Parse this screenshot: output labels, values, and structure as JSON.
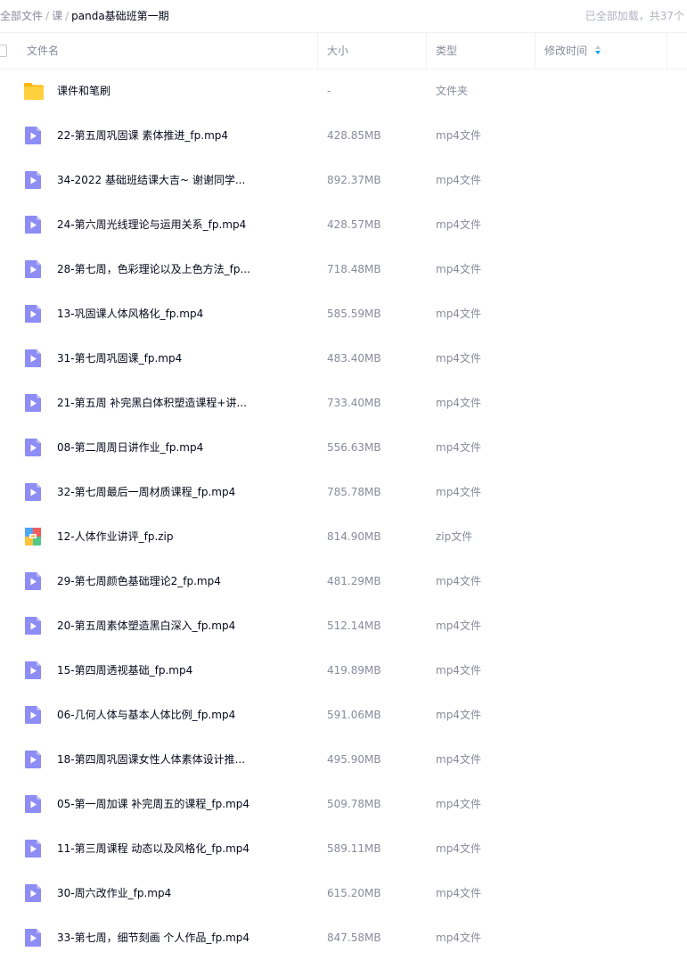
{
  "breadcrumb": {
    "items": [
      "全部文件",
      "课"
    ],
    "separator": "/",
    "current": "panda基础班第一期"
  },
  "load_status": "已全部加载，共37个",
  "columns": {
    "name": "文件名",
    "size": "大小",
    "type": "类型",
    "modified": "修改时间"
  },
  "colors": {
    "accent": "#06a7ff",
    "video_icon": "#8e8cf5",
    "folder_icon": "#ffc52e"
  },
  "files": [
    {
      "icon": "folder-icon",
      "name": "课件和笔刷",
      "size": "-",
      "type": "文件夹"
    },
    {
      "icon": "video-file-icon",
      "name": "22-第五周巩固课 素体推进_fp.mp4",
      "size": "428.85MB",
      "type": "mp4文件"
    },
    {
      "icon": "video-file-icon",
      "name": "34-2022 基础班结课大吉~ 谢谢同学...",
      "size": "892.37MB",
      "type": "mp4文件"
    },
    {
      "icon": "video-file-icon",
      "name": "24-第六周光线理论与运用关系_fp.mp4",
      "size": "428.57MB",
      "type": "mp4文件"
    },
    {
      "icon": "video-file-icon",
      "name": "28-第七周，色彩理论以及上色方法_fp...",
      "size": "718.48MB",
      "type": "mp4文件"
    },
    {
      "icon": "video-file-icon",
      "name": "13-巩固课人体风格化_fp.mp4",
      "size": "585.59MB",
      "type": "mp4文件"
    },
    {
      "icon": "video-file-icon",
      "name": "31-第七周巩固课_fp.mp4",
      "size": "483.40MB",
      "type": "mp4文件"
    },
    {
      "icon": "video-file-icon",
      "name": "21-第五周 补完黑白体积塑造课程+讲...",
      "size": "733.40MB",
      "type": "mp4文件"
    },
    {
      "icon": "video-file-icon",
      "name": "08-第二周周日讲作业_fp.mp4",
      "size": "556.63MB",
      "type": "mp4文件"
    },
    {
      "icon": "video-file-icon",
      "name": "32-第七周最后一周材质课程_fp.mp4",
      "size": "785.78MB",
      "type": "mp4文件"
    },
    {
      "icon": "zip-file-icon",
      "name": "12-人体作业讲评_fp.zip",
      "size": "814.90MB",
      "type": "zip文件"
    },
    {
      "icon": "video-file-icon",
      "name": "29-第七周颜色基础理论2_fp.mp4",
      "size": "481.29MB",
      "type": "mp4文件"
    },
    {
      "icon": "video-file-icon",
      "name": "20-第五周素体塑造黑白深入_fp.mp4",
      "size": "512.14MB",
      "type": "mp4文件"
    },
    {
      "icon": "video-file-icon",
      "name": "15-第四周透视基础_fp.mp4",
      "size": "419.89MB",
      "type": "mp4文件"
    },
    {
      "icon": "video-file-icon",
      "name": "06-几何人体与基本人体比例_fp.mp4",
      "size": "591.06MB",
      "type": "mp4文件"
    },
    {
      "icon": "video-file-icon",
      "name": "18-第四周巩固课女性人体素体设计推...",
      "size": "495.90MB",
      "type": "mp4文件"
    },
    {
      "icon": "video-file-icon",
      "name": "05-第一周加课 补完周五的课程_fp.mp4",
      "size": "509.78MB",
      "type": "mp4文件"
    },
    {
      "icon": "video-file-icon",
      "name": "11-第三周课程 动态以及风格化_fp.mp4",
      "size": "589.11MB",
      "type": "mp4文件"
    },
    {
      "icon": "video-file-icon",
      "name": "30-周六改作业_fp.mp4",
      "size": "615.20MB",
      "type": "mp4文件"
    },
    {
      "icon": "video-file-icon",
      "name": "33-第七周，细节刻画 个人作品_fp.mp4",
      "size": "847.58MB",
      "type": "mp4文件"
    }
  ]
}
